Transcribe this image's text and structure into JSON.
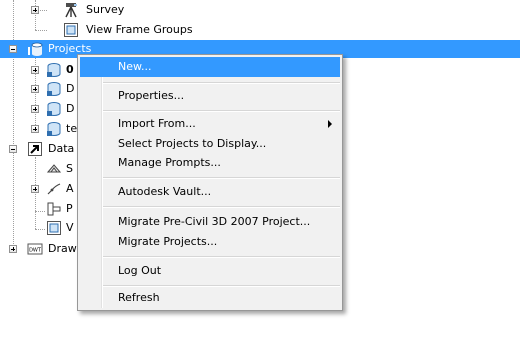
{
  "tree": {
    "survey_label": "Survey",
    "view_frame_groups_label": "View Frame Groups",
    "projects_label": "Projects",
    "project_child_1_label": "0",
    "project_child_2_label": "D",
    "project_child_3_label": "D",
    "project_child_4_label": "te",
    "data_shortcuts_label": "Data",
    "ds_child_1_label": "S",
    "ds_child_2_label": "A",
    "ds_child_3_label": "P",
    "ds_child_4_label": "V",
    "drawing_templates_label": "Draw",
    "drawing_badge_text": "DWT"
  },
  "context_menu": {
    "items": [
      {
        "label": "New...",
        "highlighted": true
      },
      {
        "label": "Properties..."
      },
      {
        "label": "Import From...",
        "has_submenu": true
      },
      {
        "label": "Select Projects to Display..."
      },
      {
        "label": "Manage Prompts..."
      },
      {
        "label": "Autodesk Vault..."
      },
      {
        "label": "Migrate Pre-Civil 3D 2007 Project..."
      },
      {
        "label": "Migrate Projects..."
      },
      {
        "label": "Log Out"
      },
      {
        "label": "Refresh"
      }
    ]
  },
  "colors": {
    "selection": "#3399ff",
    "menu_background": "#f1f1f1",
    "tree_lines": "#a0a0a0"
  }
}
